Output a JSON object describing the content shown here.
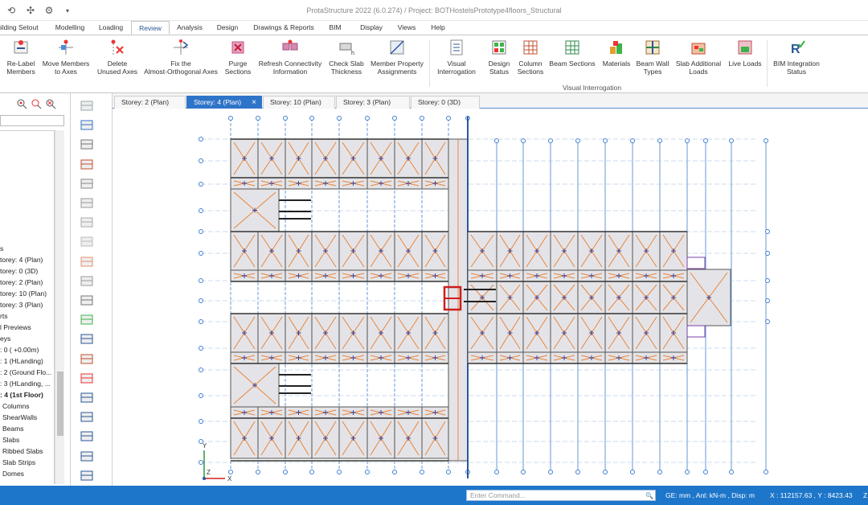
{
  "window": {
    "title": "ProtaStructure 2022 (6.0.274) / Project: BOTHostelsPrototype4floors_Structural"
  },
  "ribbon_tabs": [
    {
      "label": "Building Setout"
    },
    {
      "label": "Modelling"
    },
    {
      "label": "Loading"
    },
    {
      "label": "Review"
    },
    {
      "label": "Analysis"
    },
    {
      "label": "Design"
    },
    {
      "label": "Drawings & Reports"
    },
    {
      "label": "BIM"
    },
    {
      "label": "Display"
    },
    {
      "label": "Views"
    },
    {
      "label": "Help"
    }
  ],
  "ribbon_buttons": [
    {
      "label": "Re-Label\nMembers",
      "icon": "relabel-icon"
    },
    {
      "label": "Move Members\nto Axes",
      "icon": "move-members-icon"
    },
    {
      "label": "Delete\nUnused Axes",
      "icon": "delete-axes-icon"
    },
    {
      "label": "Fix the\nAlmost-Orthogonal Axes",
      "icon": "fix-axes-icon"
    },
    {
      "label": "Purge\nSections",
      "icon": "purge-icon"
    },
    {
      "label": "Refresh Connectivity\nInformation",
      "icon": "refresh-icon"
    },
    {
      "label": "Check Slab\nThickness",
      "icon": "slab-thickness-icon"
    },
    {
      "label": "Member Property\nAssignments",
      "icon": "member-property-icon"
    },
    {
      "label": "Visual\nInterrogation",
      "icon": "visual-interrogation-icon"
    },
    {
      "label": "Design\nStatus",
      "icon": "design-status-icon"
    },
    {
      "label": "Column\nSections",
      "icon": "column-sections-icon"
    },
    {
      "label": "Beam Sections",
      "icon": "beam-sections-icon"
    },
    {
      "label": "Materials",
      "icon": "materials-icon"
    },
    {
      "label": "Beam Wall\nTypes",
      "icon": "beam-wall-icon"
    },
    {
      "label": "Slab Additional\nLoads",
      "icon": "slab-loads-icon"
    },
    {
      "label": "Live Loads",
      "icon": "live-loads-icon"
    },
    {
      "label": "BIM Integration\nStatus",
      "icon": "bim-status-icon"
    }
  ],
  "ribbon_group_label": "Visual Interrogation",
  "tree": [
    "s",
    "torey: 4 (Plan)",
    "torey: 0 (3D)",
    "torey: 2 (Plan)",
    "torey: 10 (Plan)",
    "torey: 3 (Plan)",
    "rts",
    "l Previews",
    "eys",
    ": 0 ( +0.00m)",
    ": 1 (HLanding)",
    ": 2 (Ground Flo...",
    ": 3 (HLanding, ...",
    ": 4 (1st Floor)",
    "Columns",
    "ShearWalls",
    "Beams",
    "Slabs",
    "Ribbed Slabs",
    "Slab Strips",
    "Domes"
  ],
  "doc_tabs": [
    {
      "label": "Storey: 2 (Plan)"
    },
    {
      "label": "Storey: 4 (Plan)"
    },
    {
      "label": "Storey: 10 (Plan)"
    },
    {
      "label": "Storey: 3 (Plan)"
    },
    {
      "label": "Storey: 0 (3D)"
    }
  ],
  "doc_close": "×",
  "axis": {
    "y": "Y",
    "x": "X",
    "z": "Z"
  },
  "statusbar": {
    "command_placeholder": "Enter Command...",
    "units": "GE: mm , Anl: kN-m , Disp: m",
    "coords": "X : 112157.63 , Y : 8423.43",
    "trailing": "Z"
  },
  "colors": {
    "accent": "#2e74c8",
    "status_bar": "#1d76c9",
    "slab_fill": "#e4e4e8",
    "beam_orange": "#e8853a",
    "axis_blue": "#3f7fd0",
    "highlight_red": "#cc1f1f"
  }
}
